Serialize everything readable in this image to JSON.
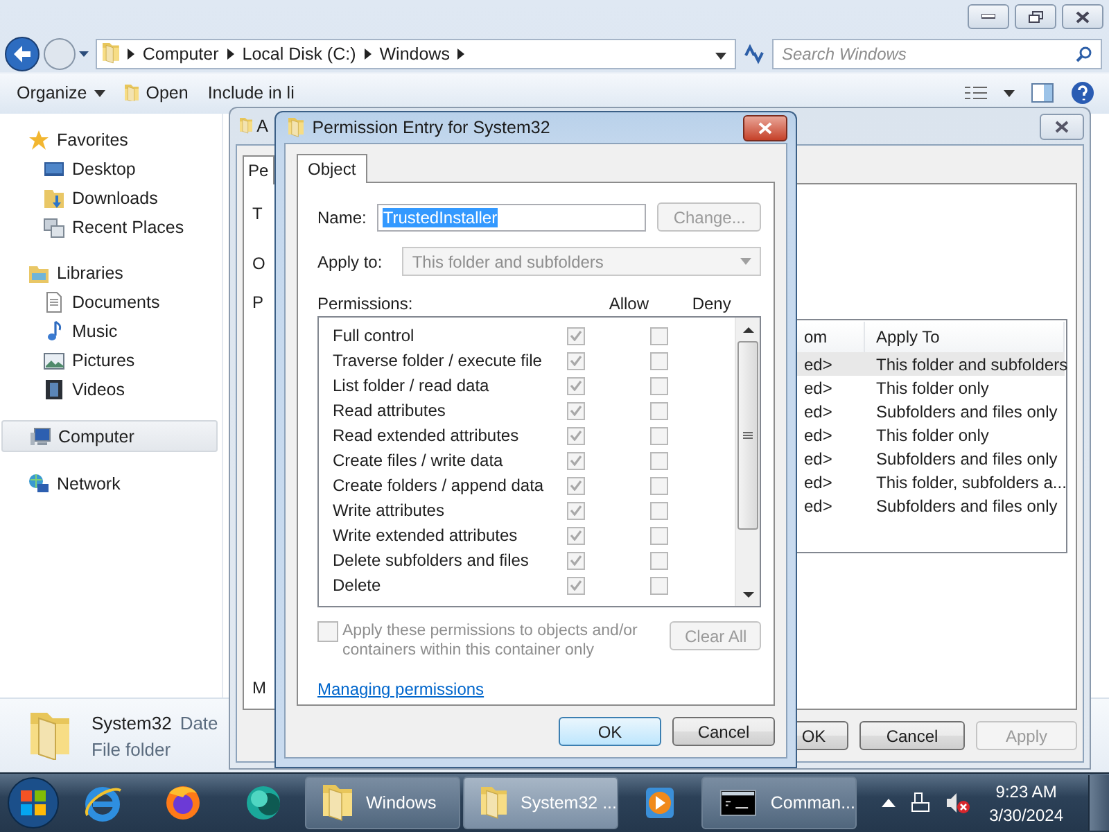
{
  "explorer": {
    "address": {
      "crumbs": [
        "Computer",
        "Local Disk (C:)",
        "Windows"
      ]
    },
    "search": {
      "placeholder": "Search Windows"
    },
    "toolbar": [
      {
        "label": "Organize",
        "kind": "menu"
      },
      {
        "label": "Open",
        "kind": "open"
      },
      {
        "label": "Include in li",
        "kind": "plain"
      }
    ],
    "sidebar": [
      {
        "label": "Favorites",
        "kind": "star",
        "selected": false,
        "children": [
          {
            "label": "Desktop",
            "kind": "desktop",
            "selected": false
          },
          {
            "label": "Downloads",
            "kind": "downloads",
            "selected": false
          },
          {
            "label": "Recent Places",
            "kind": "recent",
            "selected": false
          }
        ]
      },
      {
        "label": "Libraries",
        "kind": "libraries",
        "selected": false,
        "children": [
          {
            "label": "Documents",
            "kind": "document",
            "selected": false
          },
          {
            "label": "Music",
            "kind": "music",
            "selected": false
          },
          {
            "label": "Pictures",
            "kind": "pictures",
            "selected": false
          },
          {
            "label": "Videos",
            "kind": "videos",
            "selected": false
          }
        ]
      },
      {
        "label": "Computer",
        "kind": "computer",
        "selected": true
      },
      {
        "label": "Network",
        "kind": "network",
        "selected": false
      }
    ],
    "details": {
      "name": "System32",
      "field": "Date",
      "type": "File folder"
    }
  },
  "advanced_dialog": {
    "title": "A",
    "tabs": [
      {
        "label": "Pe",
        "selected": true
      }
    ],
    "fragments": [
      "T",
      "O",
      "P",
      "M"
    ],
    "entries": {
      "columns": [
        "om",
        "Apply To"
      ],
      "rows": [
        {
          "column_1": "ed>",
          "apply_to": "This folder and subfolders",
          "selected": true
        },
        {
          "column_1": "ed>",
          "apply_to": "This folder only",
          "selected": false
        },
        {
          "column_1": "ed>",
          "apply_to": "Subfolders and files only",
          "selected": false
        },
        {
          "column_1": "ed>",
          "apply_to": "This folder only",
          "selected": false
        },
        {
          "column_1": "ed>",
          "apply_to": "Subfolders and files only",
          "selected": false
        },
        {
          "column_1": "ed>",
          "apply_to": "This folder, subfolders a...",
          "selected": false
        },
        {
          "column_1": "ed>",
          "apply_to": "Subfolders and files only",
          "selected": false
        }
      ]
    },
    "buttons": [
      {
        "label": "OK",
        "disabled": false
      },
      {
        "label": "Cancel",
        "disabled": false
      },
      {
        "label": "Apply",
        "disabled": true
      }
    ]
  },
  "permission_dialog": {
    "title": "Permission Entry for System32",
    "tabs": [
      {
        "label": "Object",
        "selected": true
      }
    ],
    "name": {
      "label": "Name:",
      "value": "TrustedInstaller",
      "selected": true
    },
    "change_button": {
      "label": "Change...",
      "disabled": true
    },
    "apply_to": {
      "label": "Apply to:",
      "value": "This folder and subfolders",
      "disabled": true
    },
    "permissions": {
      "label": "Permissions:",
      "columns": [
        "Allow",
        "Deny"
      ],
      "disabled": true,
      "rows": [
        {
          "name": "Full control",
          "allow": true,
          "deny": false
        },
        {
          "name": "Traverse folder / execute file",
          "allow": true,
          "deny": false
        },
        {
          "name": "List folder / read data",
          "allow": true,
          "deny": false
        },
        {
          "name": "Read attributes",
          "allow": true,
          "deny": false
        },
        {
          "name": "Read extended attributes",
          "allow": true,
          "deny": false
        },
        {
          "name": "Create files / write data",
          "allow": true,
          "deny": false
        },
        {
          "name": "Create folders / append data",
          "allow": true,
          "deny": false
        },
        {
          "name": "Write attributes",
          "allow": true,
          "deny": false
        },
        {
          "name": "Write extended attributes",
          "allow": true,
          "deny": false
        },
        {
          "name": "Delete subfolders and files",
          "allow": true,
          "deny": false
        },
        {
          "name": "Delete",
          "allow": true,
          "deny": false
        }
      ]
    },
    "inherit_checkbox": {
      "label": "Apply these permissions to objects and/or containers within this container only",
      "checked": false,
      "disabled": true
    },
    "clear_button": {
      "label": "Clear All",
      "disabled": true
    },
    "link": "Managing permissions",
    "buttons": [
      {
        "label": "OK",
        "default": true
      },
      {
        "label": "Cancel",
        "default": false
      }
    ]
  },
  "taskbar": {
    "items": [
      {
        "kind": "ie"
      },
      {
        "kind": "firefox"
      },
      {
        "kind": "teal"
      },
      {
        "kind": "folder",
        "label": "Windows",
        "selected": false
      },
      {
        "kind": "folder",
        "label": "System32 ...",
        "selected": true
      },
      {
        "kind": "media"
      },
      {
        "kind": "console",
        "label": "Comman...",
        "selected": false
      }
    ],
    "clock": {
      "time": "9:23 AM",
      "date": "3/30/2024"
    }
  }
}
